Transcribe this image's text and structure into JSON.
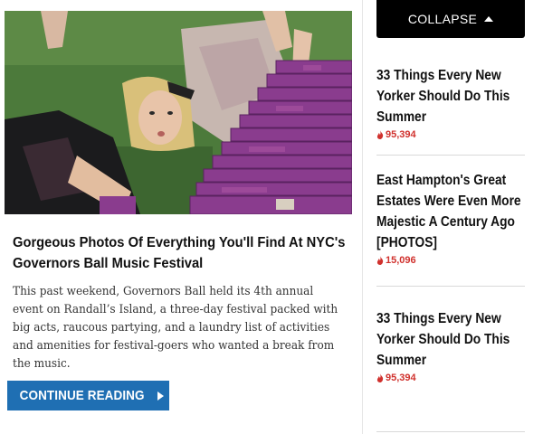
{
  "article": {
    "image_alt_icon": "festival-photo",
    "headline": "Gorgeous Photos Of Everything You'll Find At NYC's Governors Ball Music Festival",
    "summary": "This past weekend, Governors Ball held its 4th annual event on Randall’s Island, a three-day festival packed with big acts, raucous partying, and a laundry list of activities and amenities for festival-goers who wanted a break from the music.",
    "cta_label": "CONTINUE READING",
    "cta_icon": "play-arrow-icon"
  },
  "sidebar": {
    "collapse_label": "COLLAPSE",
    "collapse_icon": "caret-up-icon",
    "accent_color": "#d0312d",
    "items": [
      {
        "title": "33 Things Every New Yorker Should Do This Summer",
        "count": "95,394"
      },
      {
        "title": "East Hampton's Great Estates Were Even More Majestic A Century Ago [PHOTOS]",
        "count": "15,096"
      },
      {
        "title": "33 Things Every New Yorker Should Do This Summer",
        "count": "95,394"
      }
    ]
  },
  "colors": {
    "cta_bg": "#1f6fb3",
    "collapse_bg": "#000000"
  }
}
